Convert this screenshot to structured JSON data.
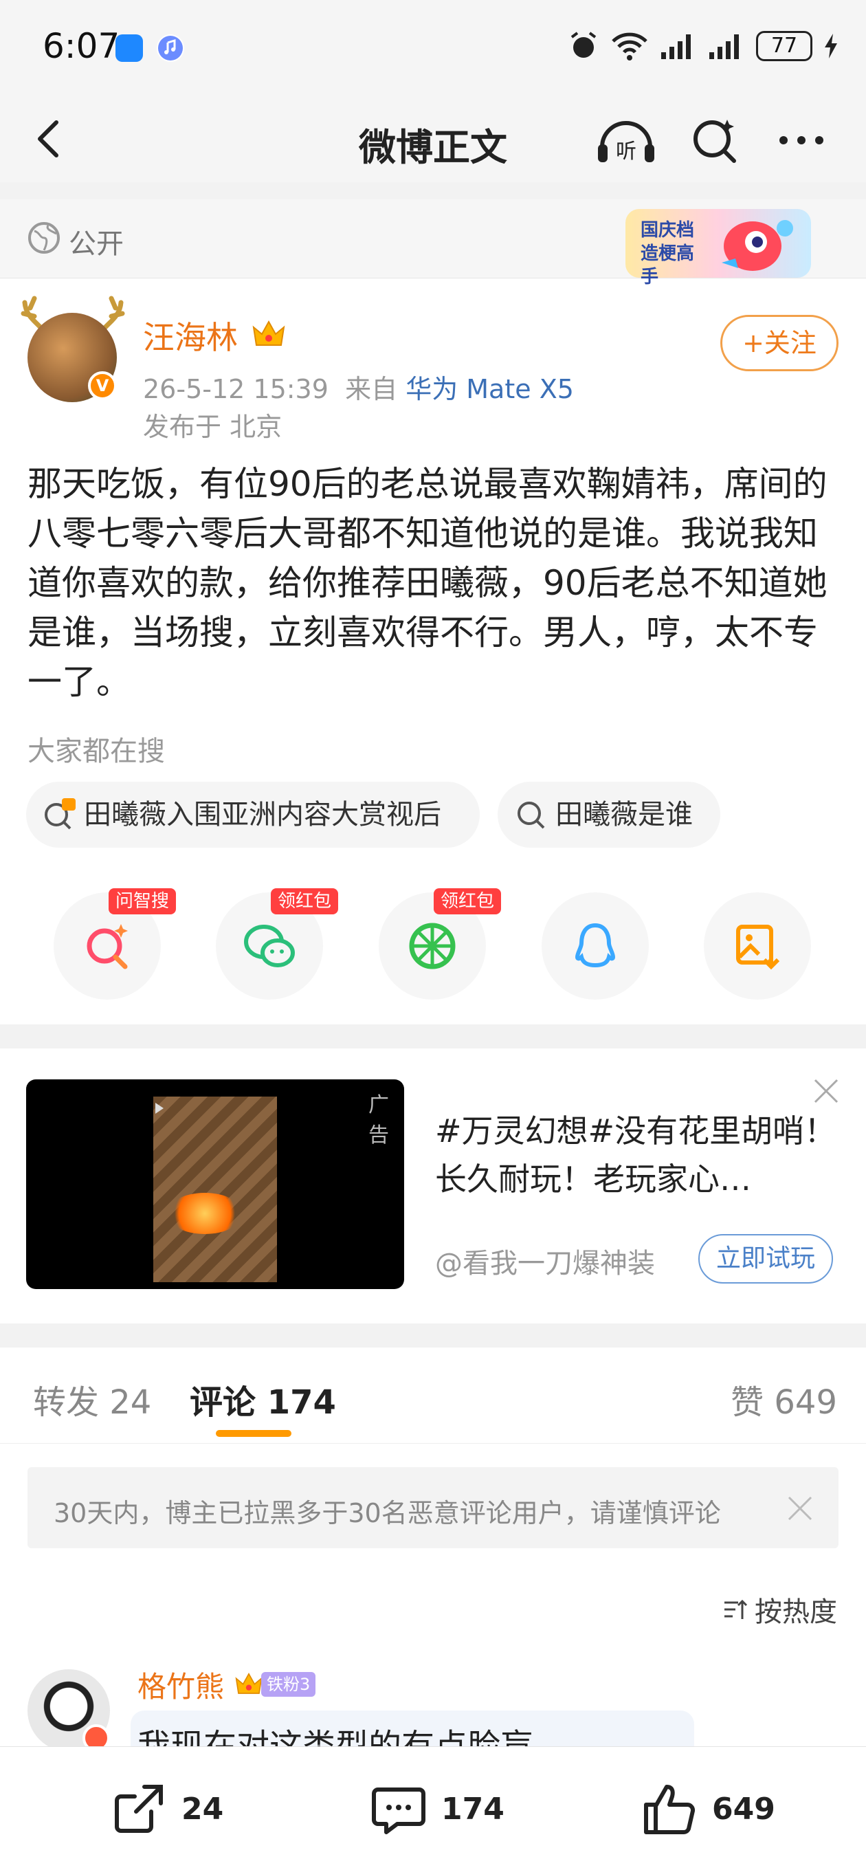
{
  "status_bar": {
    "time": "6:07",
    "battery": "77"
  },
  "nav": {
    "title": "微博正文",
    "listen_label": "听"
  },
  "visibility": {
    "label": "公开",
    "badge_text": "国庆档造梗高手"
  },
  "post": {
    "author": "汪海林",
    "timestamp": "26-5-12 15:39",
    "from_prefix": "来自",
    "device": "华为 Mate X5",
    "location": "发布于 北京",
    "follow_label": "+关注",
    "verified_mark": "V",
    "text": "那天吃饭，有位90后的老总说最喜欢鞠婧祎，席间的八零七零六零后大哥都不知道他说的是谁。我说我知道你喜欢的款，给你推荐田曦薇，90后老总不知道她是谁，当场搜，立刻喜欢得不行。男人，哼，太不专一了。"
  },
  "trending": {
    "title": "大家都在搜",
    "chips": [
      {
        "label": "田曦薇入围亚洲内容大赏视后",
        "icon": "hot-search-icon"
      },
      {
        "label": "田曦薇是谁",
        "icon": "search-icon"
      }
    ]
  },
  "share_buttons": [
    {
      "name": "ai-search",
      "tag": "问智搜"
    },
    {
      "name": "wechat",
      "tag": "领红包"
    },
    {
      "name": "moments",
      "tag": "领红包"
    },
    {
      "name": "qq",
      "tag": ""
    },
    {
      "name": "save-image",
      "tag": ""
    }
  ],
  "ad": {
    "tag": "广告",
    "headline": "#万灵幻想#没有花里胡哨！长久耐玩！老玩家心…",
    "account": "@看我一刀爆神装",
    "cta": "立即试玩"
  },
  "tabs": {
    "repost": "转发 24",
    "comments": "评论 174",
    "likes": "赞 649"
  },
  "notice": {
    "text": "30天内，博主已拉黑多于30名恶意评论用户，请谨慎评论"
  },
  "sort": {
    "label": "按热度"
  },
  "comment": {
    "user": "格竹熊",
    "fan_badge": "铁粉3",
    "text": "我现在对这类型的有点脸盲"
  },
  "bottom_bar": {
    "repost_count": "24",
    "comment_count": "174",
    "like_count": "649"
  },
  "colors": {
    "accent_orange": "#ee7a1b",
    "link_blue": "#3b6fb6",
    "tab_underline": "#ff9a00",
    "red_tag": "#ff3f3f"
  }
}
